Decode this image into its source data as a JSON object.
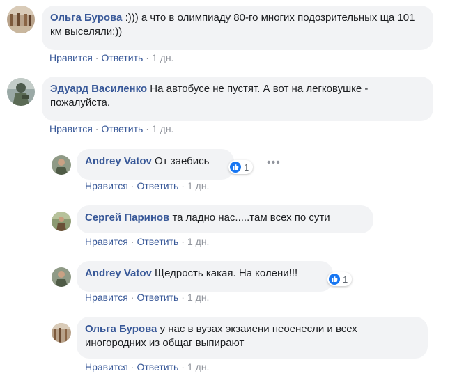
{
  "actions": {
    "like": "Нравится",
    "reply": "Ответить",
    "sep": "·"
  },
  "comments": [
    {
      "author": "Ольга Бурова",
      "text": ":))) а что в олимпиаду 80-го многих подозрительных ща 101 км выселяли:))",
      "time": "1 дн."
    },
    {
      "author": "Эдуард Василенко",
      "text": "На автобусе не пустят. А вот на легковушке - пожалуйста.",
      "time": "1 дн."
    },
    {
      "author": "Andrey Vatov",
      "text": "От заебись",
      "time": "1 дн.",
      "reaction_count": "1",
      "more": "•••"
    },
    {
      "author": "Сергей Паринов",
      "text": "та ладно нас.....там всех по сути",
      "time": "1 дн."
    },
    {
      "author": "Andrey Vatov",
      "text": "Щедрость какая. На колени!!!",
      "time": "1 дн.",
      "reaction_count": "1"
    },
    {
      "author": "Ольга Бурова",
      "text": "у нас в вузах экзаиени пеоенесли и всех иногородних из общаг выпирают",
      "time": "1 дн."
    }
  ],
  "colors": {
    "author": "#385898",
    "bubble": "#f2f3f5",
    "meta": "#90949c",
    "like_badge": "#1877f2"
  }
}
